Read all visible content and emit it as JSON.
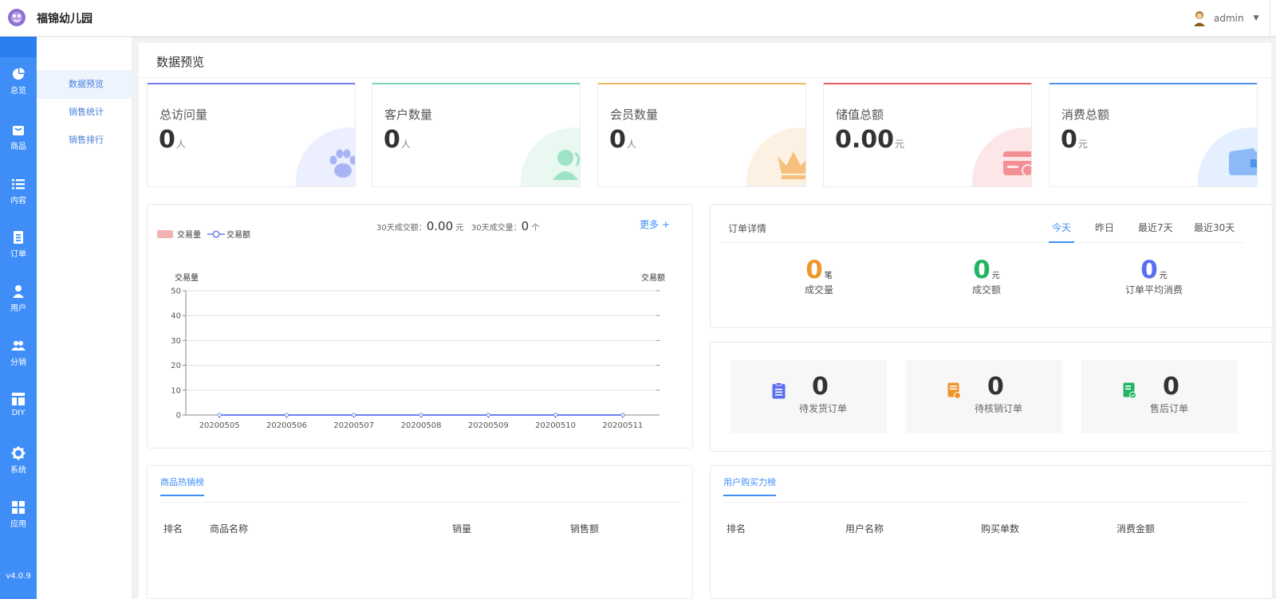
{
  "app": {
    "title": "福锦幼儿园"
  },
  "user": {
    "name": "admin"
  },
  "sidebar": {
    "items": [
      {
        "label": "总览",
        "icon": "pie-chart-icon"
      },
      {
        "label": "商品",
        "icon": "shopping-bag-icon"
      },
      {
        "label": "内容",
        "icon": "list-icon"
      },
      {
        "label": "订单",
        "icon": "document-icon"
      },
      {
        "label": "用户",
        "icon": "user-icon"
      },
      {
        "label": "分销",
        "icon": "users-icon"
      },
      {
        "label": "DIY",
        "icon": "layout-icon"
      },
      {
        "label": "系统",
        "icon": "gear-icon"
      },
      {
        "label": "应用",
        "icon": "grid-icon"
      }
    ],
    "version": "v4.0.9"
  },
  "subnav": {
    "items": [
      "数据预览",
      "销售统计",
      "销售排行"
    ]
  },
  "page": {
    "title": "数据预览"
  },
  "stats": [
    {
      "label": "总访问量",
      "value": "0",
      "unit": "人",
      "color": "#6f7ff2",
      "tint": "#eceffe",
      "icon": "paw-icon"
    },
    {
      "label": "客户数量",
      "value": "0",
      "unit": "人",
      "color": "#7ed6b8",
      "tint": "#e9f8f1",
      "icon": "customer-icon"
    },
    {
      "label": "会员数量",
      "value": "0",
      "unit": "人",
      "color": "#f2b45d",
      "tint": "#fdf1e4",
      "icon": "crown-icon"
    },
    {
      "label": "储值总额",
      "value": "0.00",
      "unit": "元",
      "color": "#e85c66",
      "tint": "#fde6e7",
      "icon": "card-icon"
    },
    {
      "label": "消费总额",
      "value": "0",
      "unit": "元",
      "color": "#4f93f0",
      "tint": "#e4efff",
      "icon": "wallet-icon"
    }
  ],
  "trend": {
    "legend_volume": "交易量",
    "legend_amount": "交易额",
    "amount_label": "30天成交额：",
    "amount_value": "0.00",
    "amount_unit": "元",
    "count_label": "30天成交量：",
    "count_value": "0",
    "count_unit": "个",
    "more": "更多 +"
  },
  "chart_data": {
    "type": "line",
    "categories": [
      "20200505",
      "20200506",
      "20200507",
      "20200508",
      "20200509",
      "20200510",
      "20200511"
    ],
    "series": [
      {
        "name": "交易量",
        "type": "bar",
        "values": [
          0,
          0,
          0,
          0,
          0,
          0,
          0
        ],
        "color": "#f0b3b3"
      },
      {
        "name": "交易额",
        "type": "line",
        "values": [
          0,
          0,
          0,
          0,
          0,
          0,
          0
        ],
        "color": "#6f7ff2"
      }
    ],
    "ylabel": "交易量",
    "y2label": "交易额",
    "ylim": [
      0,
      50
    ],
    "yticks": [
      0,
      10,
      20,
      30,
      40,
      50
    ],
    "grid": true,
    "legend": "top-left"
  },
  "order_detail": {
    "title": "订单详情",
    "tabs": [
      "今天",
      "昨日",
      "最近7天",
      "最近30天"
    ],
    "metrics": [
      {
        "value": "0",
        "unit": "笔",
        "label": "成交量",
        "color": "#f0962e"
      },
      {
        "value": "0",
        "unit": "元",
        "label": "成交额",
        "color": "#22b463"
      },
      {
        "value": "0",
        "unit": "元",
        "label": "订单平均消费",
        "color": "#5b6ef0"
      }
    ]
  },
  "pending": [
    {
      "value": "0",
      "label": "待发货订单",
      "color": "#5b6ef0",
      "icon": "clipboard-icon"
    },
    {
      "value": "0",
      "label": "待核销订单",
      "color": "#f0962e",
      "icon": "receipt-icon"
    },
    {
      "value": "0",
      "label": "售后订单",
      "color": "#22b463",
      "icon": "aftersale-icon"
    }
  ],
  "hot_products": {
    "tab": "商品热销榜",
    "columns": [
      "排名",
      "商品名称",
      "销量",
      "销售额"
    ]
  },
  "buying_power": {
    "tab": "用户购买力榜",
    "columns": [
      "排名",
      "用户名称",
      "购买单数",
      "消费金额"
    ]
  }
}
